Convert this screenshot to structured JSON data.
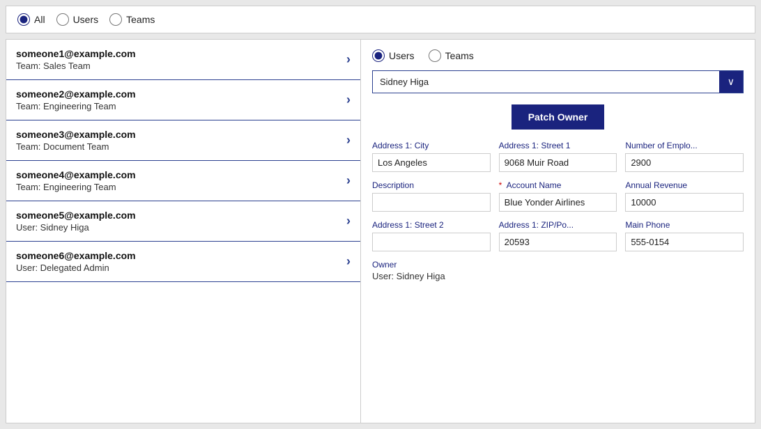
{
  "topFilter": {
    "options": [
      {
        "id": "all",
        "label": "All",
        "checked": true
      },
      {
        "id": "users",
        "label": "Users",
        "checked": false
      },
      {
        "id": "teams",
        "label": "Teams",
        "checked": false
      }
    ]
  },
  "leftPanel": {
    "items": [
      {
        "email": "someone1@example.com",
        "sub": "Team: Sales Team"
      },
      {
        "email": "someone2@example.com",
        "sub": "Team: Engineering Team"
      },
      {
        "email": "someone3@example.com",
        "sub": "Team: Document Team"
      },
      {
        "email": "someone4@example.com",
        "sub": "Team: Engineering Team"
      },
      {
        "email": "someone5@example.com",
        "sub": "User: Sidney Higa"
      },
      {
        "email": "someone6@example.com",
        "sub": "User: Delegated Admin"
      }
    ]
  },
  "rightPanel": {
    "radioOptions": [
      {
        "id": "r-users",
        "label": "Users",
        "checked": true
      },
      {
        "id": "r-teams",
        "label": "Teams",
        "checked": false
      }
    ],
    "dropdown": {
      "value": "Sidney Higa",
      "placeholder": "Sidney Higa"
    },
    "patchOwnerButton": "Patch Owner",
    "fields": [
      {
        "label": "Address 1: City",
        "value": "Los Angeles",
        "required": false
      },
      {
        "label": "Address 1: Street 1",
        "value": "9068 Muir Road",
        "required": false
      },
      {
        "label": "Number of Emplo...",
        "value": "2900",
        "required": false
      },
      {
        "label": "Description",
        "value": "",
        "required": false
      },
      {
        "label": "Account Name",
        "value": "Blue Yonder Airlines",
        "required": true
      },
      {
        "label": "Annual Revenue",
        "value": "10000",
        "required": false
      },
      {
        "label": "Address 1: Street 2",
        "value": "",
        "required": false
      },
      {
        "label": "Address 1: ZIP/Po...",
        "value": "20593",
        "required": false
      },
      {
        "label": "Main Phone",
        "value": "555-0154",
        "required": false
      }
    ],
    "owner": {
      "label": "Owner",
      "value": "User: Sidney Higa"
    }
  }
}
